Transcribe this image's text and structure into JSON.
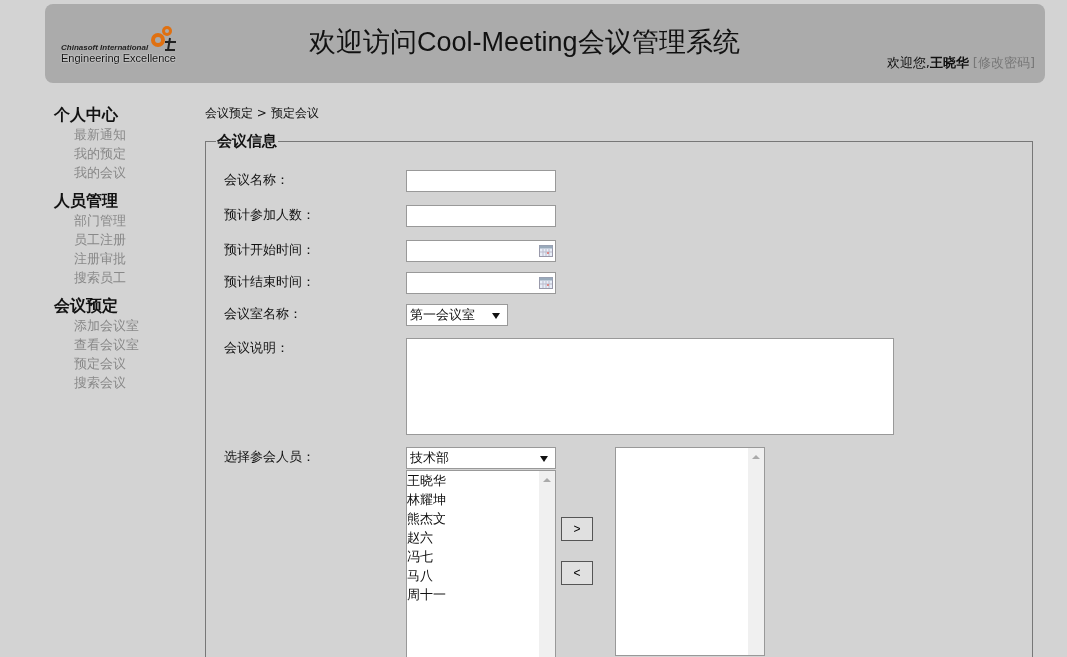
{
  "header": {
    "logo": {
      "line_1": "Chinasoft International",
      "line_2": "Engineering Excellence"
    },
    "title": "欢迎访问Cool-Meeting会议管理系统",
    "greeting": "欢迎您,",
    "user": "王晓华",
    "change_password": "[修改密码]"
  },
  "sidebar": [
    {
      "title": "个人中心",
      "items": [
        "最新通知",
        "我的预定",
        "我的会议"
      ]
    },
    {
      "title": "人员管理",
      "items": [
        "部门管理",
        "员工注册",
        "注册审批",
        "搜索员工"
      ]
    },
    {
      "title": "会议预定",
      "items": [
        "添加会议室",
        "查看会议室",
        "预定会议",
        "搜索会议"
      ]
    }
  ],
  "breadcrumb": "会议预定 > 预定会议",
  "form": {
    "legend": "会议信息",
    "fields": [
      {
        "kind": "text",
        "label": "会议名称："
      },
      {
        "kind": "text",
        "label": "预计参加人数："
      },
      {
        "kind": "date",
        "label": "预计开始时间："
      },
      {
        "kind": "date",
        "label": "预计结束时间："
      },
      {
        "kind": "select",
        "label": "会议室名称：",
        "value": "第一会议室"
      },
      {
        "kind": "textarea",
        "label": "会议说明："
      }
    ],
    "attendees": {
      "label": "选择参会人员：",
      "department": "技术部",
      "employees": [
        "王晓华",
        "林耀坤",
        "熊杰文",
        "赵六",
        "冯七",
        "马八",
        "周十一"
      ],
      "add_button": ">",
      "remove_button": "<"
    }
  }
}
